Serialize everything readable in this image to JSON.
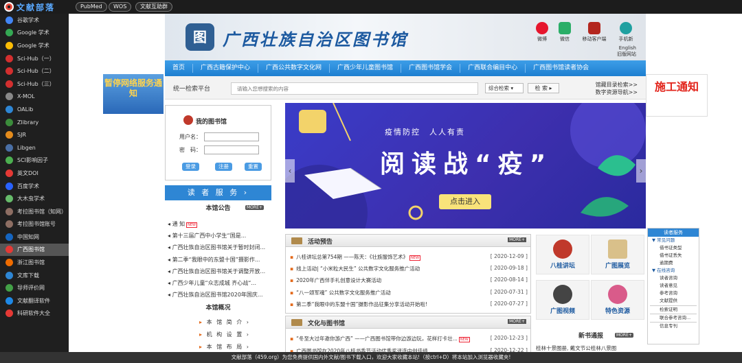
{
  "topbar": {
    "brand": "文献部落",
    "buttons": [
      "PubMed",
      "WOS",
      "文献互助群"
    ]
  },
  "sidebar": {
    "items": [
      {
        "label": "谷歌学术",
        "color": "#4285f4"
      },
      {
        "label": "Google 学术",
        "color": "#34a853"
      },
      {
        "label": "Google 学术",
        "color": "#fbbc05"
      },
      {
        "label": "Sci-Hub（一）",
        "color": "#d32f2f"
      },
      {
        "label": "Sci-Hub（二）",
        "color": "#d32f2f"
      },
      {
        "label": "Sci-Hub（三）",
        "color": "#d32f2f"
      },
      {
        "label": "X-MOL",
        "color": "#888888"
      },
      {
        "label": "OALib",
        "color": "#2e86d4"
      },
      {
        "label": "Zlibrary",
        "color": "#3b8c3b"
      },
      {
        "label": "SJR",
        "color": "#e38b1c"
      },
      {
        "label": "Libgen",
        "color": "#4a6fa5"
      },
      {
        "label": "SCI影响因子",
        "color": "#4caf50"
      },
      {
        "label": "英文DOI",
        "color": "#e53935"
      },
      {
        "label": "百度学术",
        "color": "#2962ff"
      },
      {
        "label": "大木虫学术",
        "color": "#66bb6a"
      },
      {
        "label": "考拉图书馆（知网）",
        "color": "#8d6e63"
      },
      {
        "label": "考拉图书馆账号",
        "color": "#8d6e63"
      },
      {
        "label": "中国知网",
        "color": "#1565c0"
      },
      {
        "label": "广西图书馆",
        "color": "#e53935"
      },
      {
        "label": "浙江图书馆",
        "color": "#ef6c00"
      },
      {
        "label": "文库下载",
        "color": "#2e86d4"
      },
      {
        "label": "导师评价网",
        "color": "#43a047"
      },
      {
        "label": "文献翻译软件",
        "color": "#1e88e5"
      },
      {
        "label": "科研软件大全",
        "color": "#e53935"
      }
    ],
    "active_index": 18
  },
  "library": {
    "seal": "图",
    "title": "广西壮族自治区图书馆",
    "header_icons": [
      "微博",
      "微信",
      "移动客户端",
      "手机新"
    ],
    "lang": [
      "English",
      "旧版网站"
    ],
    "nav": [
      "首页",
      "广西古籍保护中心",
      "广西公共数字文化网",
      "广西少年儿童图书馆",
      "广西图书馆学会",
      "广西联合编目中心",
      "广西图书馆读者协会"
    ],
    "search": {
      "label": "统一检索平台",
      "placeholder": "请输入您想搜索的内容",
      "type": "综合检索",
      "button": "检 索",
      "links": [
        "馆藏目录检索>>",
        "数字资源导航>>"
      ]
    },
    "login": {
      "title": "我的图书馆",
      "username_label": "用户名：",
      "password_label": "密　码：",
      "buttons": [
        "登录",
        "注册",
        "重置"
      ]
    },
    "reader_service": "读 者 服 务",
    "notice": {
      "title": "本馆公告",
      "more": "MORE+",
      "items": [
        "通 知",
        "第十三届广西中小学生“国是...",
        "广西壮族自治区图书馆关于暂时封闭...",
        "第二季“我眼中的东盟十国”摄影作...",
        "广西壮族自治区图书馆关于调整开放...",
        "广西少年儿童“众志成城 齐心战“...",
        "广西壮族自治区图书馆2020年国庆..."
      ]
    },
    "overview": {
      "title": "本馆概况",
      "items": [
        "本 馆 简 介",
        "机 构 设 置",
        "本 馆 布 局"
      ]
    },
    "banner": {
      "subtitle": "疫情防控　人人有责",
      "title": "阅读战“疫”",
      "button": "点击进入"
    },
    "activities": {
      "title": "活动预告",
      "more": "MORE+",
      "items": [
        {
          "text": "八桂讲坛总第754期 ——陈天：《壮族服饰艺术》",
          "date": "[ 2020-12-09 ]",
          "new": true
        },
        {
          "text": "线上活动| “小米粒大民生” 公共数字文化服务推广活动",
          "date": "[ 2020-09-18 ]",
          "new": false
        },
        {
          "text": "2020年广西伴手礼创意设计大赛活动",
          "date": "[ 2020-08-14 ]",
          "new": false
        },
        {
          "text": "“八一颂军魂” 公共数字文化服务推广活动",
          "date": "[ 2020-07-31 ]",
          "new": false
        },
        {
          "text": "第二季“我眼中的东盟十国”摄影作品征集分享活动开始啦!",
          "date": "[ 2020-07-27 ]",
          "new": false
        }
      ]
    },
    "culture": {
      "title": "文化与图书馆",
      "more": "MORE+",
      "items": [
        {
          "text": "“冬至大过年邀你游广西” ——广西图书馆带你边游边玩，花样打卡壮...",
          "date": "[ 2020-12-23 ]",
          "new": true
        },
        {
          "text": "广西图书馆在2020年八桂书香节活动优秀奖评选中创佳绩",
          "date": "[ 2020-12-22 ]",
          "new": false
        }
      ]
    },
    "tiles": [
      "八桂讲坛",
      "广图展览",
      "广图视频",
      "特色资源"
    ],
    "new_books": {
      "title": "新书通报",
      "more": "MORE+",
      "item": "桂林十景图册, 戴文节公桂林八景图"
    }
  },
  "right_service": {
    "title": "读者服务",
    "groups": [
      {
        "label": "常见问题",
        "items": [
          "借书证类型",
          "借书证丢失",
          "逾期费"
        ]
      },
      {
        "label": "在线咨询",
        "items": [
          "读者咨询",
          "读者意见",
          "参考咨询",
          "文献提供"
        ]
      }
    ],
    "boxes": [
      "检索证明",
      "联合参考咨询...",
      "信息专刊"
    ]
  },
  "ads": {
    "left": "暂停网络服务通知",
    "right": "施工通知"
  },
  "footer": "文献部落（459.org）为您免费提供国内外文献/图书下载入口，欢迎大家收藏本站!（按ctrl+D）将本站加入浏览器收藏夹!"
}
